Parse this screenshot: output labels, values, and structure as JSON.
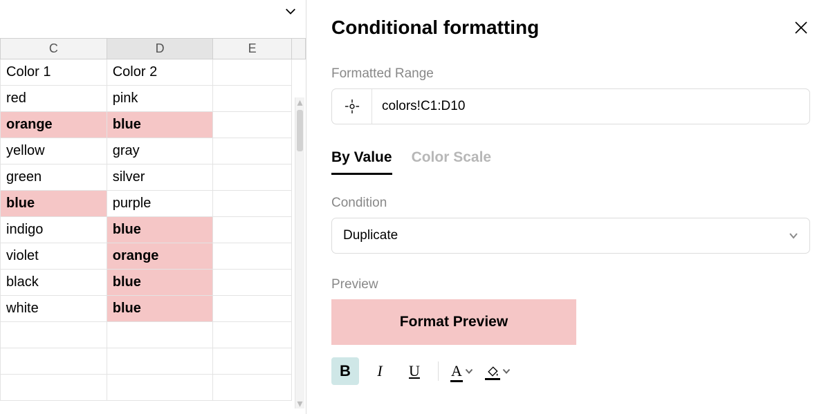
{
  "sheet": {
    "columns": [
      "C",
      "D",
      "E"
    ],
    "selected_column_index": 1,
    "rows": [
      {
        "cells": [
          {
            "v": "Color 1",
            "hi": false
          },
          {
            "v": "Color 2",
            "hi": false
          },
          {
            "v": "",
            "hi": false
          }
        ]
      },
      {
        "cells": [
          {
            "v": "red",
            "hi": false
          },
          {
            "v": "pink",
            "hi": false
          },
          {
            "v": "",
            "hi": false
          }
        ]
      },
      {
        "cells": [
          {
            "v": "orange",
            "hi": true
          },
          {
            "v": "blue",
            "hi": true
          },
          {
            "v": "",
            "hi": false
          }
        ]
      },
      {
        "cells": [
          {
            "v": "yellow",
            "hi": false
          },
          {
            "v": "gray",
            "hi": false
          },
          {
            "v": "",
            "hi": false
          }
        ]
      },
      {
        "cells": [
          {
            "v": "green",
            "hi": false
          },
          {
            "v": "silver",
            "hi": false
          },
          {
            "v": "",
            "hi": false
          }
        ]
      },
      {
        "cells": [
          {
            "v": "blue",
            "hi": true
          },
          {
            "v": "purple",
            "hi": false
          },
          {
            "v": "",
            "hi": false
          }
        ]
      },
      {
        "cells": [
          {
            "v": "indigo",
            "hi": false
          },
          {
            "v": "blue",
            "hi": true
          },
          {
            "v": "",
            "hi": false
          }
        ]
      },
      {
        "cells": [
          {
            "v": "violet",
            "hi": false
          },
          {
            "v": "orange",
            "hi": true
          },
          {
            "v": "",
            "hi": false
          }
        ]
      },
      {
        "cells": [
          {
            "v": "black",
            "hi": false
          },
          {
            "v": "blue",
            "hi": true
          },
          {
            "v": "",
            "hi": false
          }
        ]
      },
      {
        "cells": [
          {
            "v": "white",
            "hi": false
          },
          {
            "v": "blue",
            "hi": true
          },
          {
            "v": "",
            "hi": false
          }
        ]
      },
      {
        "cells": [
          {
            "v": "",
            "hi": false
          },
          {
            "v": "",
            "hi": false
          },
          {
            "v": "",
            "hi": false
          }
        ]
      },
      {
        "cells": [
          {
            "v": "",
            "hi": false
          },
          {
            "v": "",
            "hi": false
          },
          {
            "v": "",
            "hi": false
          }
        ]
      },
      {
        "cells": [
          {
            "v": "",
            "hi": false
          },
          {
            "v": "",
            "hi": false
          },
          {
            "v": "",
            "hi": false
          }
        ]
      }
    ]
  },
  "panel": {
    "title": "Conditional formatting",
    "range_label": "Formatted Range",
    "range_value": "colors!C1:D10",
    "tabs": {
      "by_value": "By Value",
      "color_scale": "Color Scale"
    },
    "condition_label": "Condition",
    "condition_value": "Duplicate",
    "preview_label": "Preview",
    "preview_text": "Format Preview",
    "format_buttons": {
      "bold": "B",
      "italic": "I",
      "underline": "U",
      "textcolor": "A"
    },
    "colors": {
      "highlight": "#f5c6c6",
      "bold_btn_bg": "#cfe7e7"
    }
  }
}
